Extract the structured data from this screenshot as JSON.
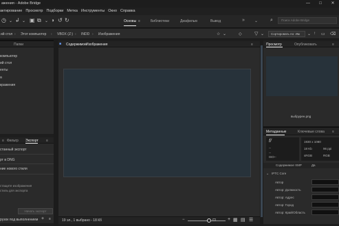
{
  "window": {
    "title": "ажения - Adobe Bridge",
    "controls": [
      "—",
      "□",
      "✕"
    ]
  },
  "menu": [
    "актирование",
    "Просмотр",
    "Подборки",
    "Метка",
    "Инструменты",
    "Окно",
    "Справка"
  ],
  "workspace_tabs": [
    "Основы",
    "Библиотеки",
    "Диафильм",
    "Вывод"
  ],
  "workspace_more": "»",
  "search_placeholder": "Поиск Adobe Bridge",
  "breadcrumb": [
    "ий стол",
    "Этот компьютер",
    "VBOX (Z:)",
    "INDD",
    "Изображения"
  ],
  "sort_label": "Сортировать по: Им",
  "left_top": {
    "tabs": [
      "",
      "Папки"
    ],
    "items": [
      "компьютер",
      "ий стол",
      "енты",
      "а",
      "кражения"
    ]
  },
  "left_bottom": {
    "tabs": [
      "Фильтр",
      "Экспорт"
    ],
    "items": [
      "станный экспорт",
      "рт в DNG",
      "ние нового стиля"
    ],
    "hint_line1": "стащите изображения",
    "hint_line2": "стиль для экспорта",
    "export_button": "Начать экспорт",
    "footer": "рузок под выполнением"
  },
  "content": {
    "tab": "Содержимое",
    "tab2": "Изображения",
    "status": "19 эл., 1 выбрано - 18 Кб"
  },
  "preview": {
    "tabs": [
      "Просмотр",
      "Опубликовать"
    ],
    "caption": "выбрурен.png"
  },
  "metadata": {
    "tabs": [
      "Метаданные",
      "Ключевые слова"
    ],
    "f_stop": "f/",
    "dashes": [
      "--",
      "--",
      "ISO--"
    ],
    "dimensions": "1930 x 1080",
    "size": "18 Kb",
    "ppi": "96 ppi",
    "color_mode": "sRGB",
    "color_mode2": "RGB",
    "xmp_row": "Содержимое XMP",
    "xmp_tab2": "Дa",
    "section": "IPTC Core",
    "fields": [
      "Автор",
      "Автор: Должность",
      "Автор: Адрес",
      "Автор: Город",
      "Автор: Край/Область"
    ]
  },
  "icons": {
    "back": "back-arrow-icon",
    "search": "search-icon"
  }
}
